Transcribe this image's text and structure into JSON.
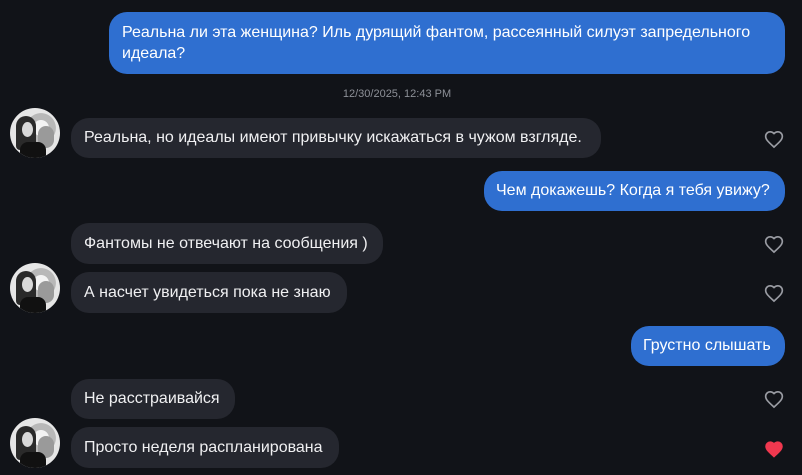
{
  "chat": {
    "timestamp": "12/30/2025, 12:43 PM",
    "messages": [
      {
        "direction": "outgoing",
        "text_line1": "Реальна ли эта женщина? Иль дурящий фантом, рассеянный силуэт запредельного",
        "text_line2": "идеала?"
      },
      {
        "direction": "incoming",
        "text": "Реальна, но идеалы имеют привычку искажаться в чужом взгляде.",
        "liked": false
      },
      {
        "direction": "outgoing",
        "text": "Чем докажешь? Когда я тебя увижу?"
      },
      {
        "direction": "incoming",
        "text": "Фантомы не отвечают на сообщения )",
        "liked": false
      },
      {
        "direction": "incoming",
        "text": "А насчет увидеться пока не знаю",
        "liked": false
      },
      {
        "direction": "outgoing",
        "text": "Грустно слышать"
      },
      {
        "direction": "incoming",
        "text": "Не расстраивайся",
        "liked": false
      },
      {
        "direction": "incoming",
        "text": "Просто неделя распланирована",
        "liked": true
      }
    ]
  },
  "colors": {
    "background": "#111318",
    "outgoing_bubble": "#2f6fd0",
    "incoming_bubble": "#25272f",
    "heart_outline": "#9a9ca3",
    "heart_liked": "#f0384f"
  },
  "icons": {
    "avatar": "avatar",
    "heart": "heart-icon",
    "heart_filled": "heart-filled-icon"
  }
}
